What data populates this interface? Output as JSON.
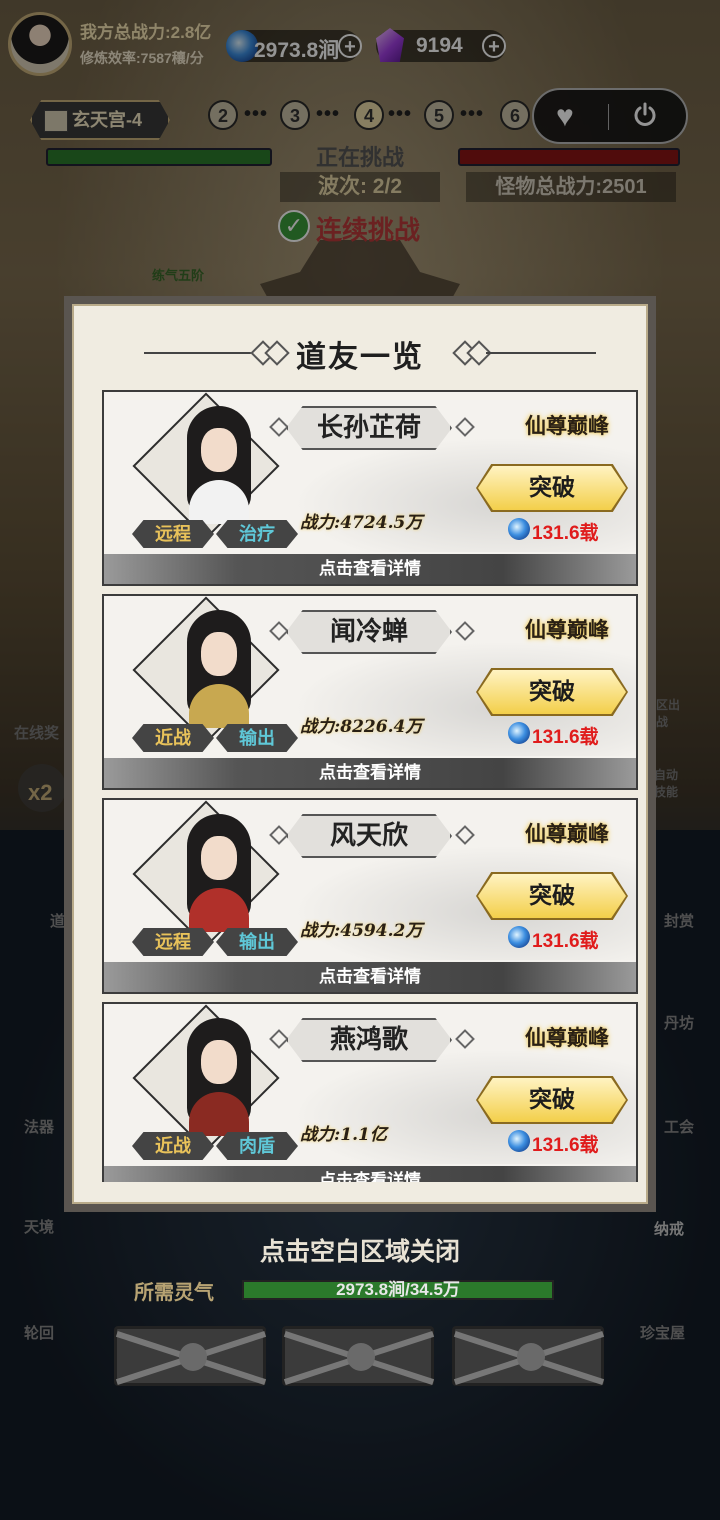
{
  "player": {
    "total_power": "我方总战力:2.8亿",
    "cultivation_rate": "修炼效率:7587穰/分"
  },
  "resources": {
    "spirit_stone": "2973.8涧",
    "crystal": "9194"
  },
  "stage": {
    "name": "玄天宫-4",
    "nodes": [
      "2",
      "3",
      "4",
      "5",
      "6"
    ],
    "status": "正在挑战",
    "wave": "波次: 2/2",
    "enemy_power": "怪物总战力:2501",
    "continuous_label": "连续挑战",
    "realm_small": "练气五阶"
  },
  "side_labels": {
    "online": "在线奖",
    "x2": "x2",
    "pvp": "区出战",
    "auto": "自动技能",
    "road": "道",
    "lore": "法器",
    "sky": "天境",
    "cycle": "轮回",
    "reward": "封赏",
    "pill": "丹坊",
    "guild": "工会",
    "bag": "纳戒",
    "treasure": "珍宝屋"
  },
  "modal": {
    "title": "道友一览",
    "companions": [
      {
        "name": "长孙芷荷",
        "realm": "仙尊巅峰",
        "power": "战力:4724.5万",
        "break_label": "突破",
        "cost": "131.6载",
        "tag1": "远程",
        "tag2": "治疗",
        "detail": "点击查看详情",
        "robe_color": "#f2f2f2"
      },
      {
        "name": "闻冷蝉",
        "realm": "仙尊巅峰",
        "power": "战力:8226.4万",
        "break_label": "突破",
        "cost": "131.6载",
        "tag1": "近战",
        "tag2": "输出",
        "detail": "点击查看详情",
        "robe_color": "#c8a850"
      },
      {
        "name": "风天欣",
        "realm": "仙尊巅峰",
        "power": "战力:4594.2万",
        "break_label": "突破",
        "cost": "131.6载",
        "tag1": "远程",
        "tag2": "输出",
        "detail": "点击查看详情",
        "robe_color": "#b0302a"
      },
      {
        "name": "燕鸿歌",
        "realm": "仙尊巅峰",
        "power": "战力:1.1亿",
        "break_label": "突破",
        "cost": "131.6载",
        "tag1": "近战",
        "tag2": "肉盾",
        "detail": "点击查看详情",
        "robe_color": "#8a2a22"
      }
    ]
  },
  "bottom": {
    "close_hint": "点击空白区域关闭",
    "spirit_label": "所需灵气",
    "spirit_progress": "2973.8涧/34.5万"
  }
}
